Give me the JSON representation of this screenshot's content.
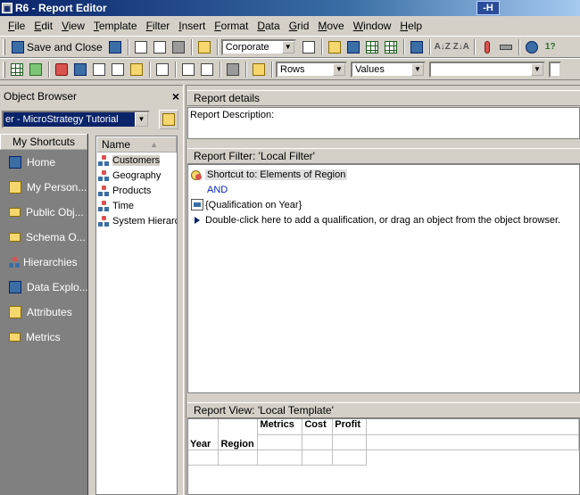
{
  "window": {
    "title": "R6 - Report Editor",
    "badge": "-H"
  },
  "menu": [
    "File",
    "Edit",
    "View",
    "Template",
    "Filter",
    "Insert",
    "Format",
    "Data",
    "Grid",
    "Move",
    "Window",
    "Help"
  ],
  "toolbar": {
    "save_close_label": "Save and Close",
    "style_combo": "Corporate",
    "rows_combo": "Rows",
    "values_combo": "Values",
    "extra_combo": "",
    "sort_asc": "A↓Z",
    "sort_desc": "Z↓A",
    "help_label": "1?"
  },
  "object_browser": {
    "title": "Object Browser",
    "close_glyph": "×",
    "project": "er - MicroStrategy Tutorial",
    "shortcuts_header": "My Shortcuts",
    "shortcuts": [
      {
        "label": "Home",
        "icon": "home-icon"
      },
      {
        "label": "My Person...",
        "icon": "my-personal-objects-icon"
      },
      {
        "label": "Public Obj...",
        "icon": "folder-icon"
      },
      {
        "label": "Schema O...",
        "icon": "folder-icon"
      },
      {
        "label": "Hierarchies",
        "icon": "hierarchy-icon"
      },
      {
        "label": "Data Explo...",
        "icon": "data-explorer-icon"
      },
      {
        "label": "Attributes",
        "icon": "attribute-icon"
      },
      {
        "label": "Metrics",
        "icon": "folder-icon"
      }
    ],
    "list_header": "Name",
    "list_sort_glyph": "▲",
    "items": [
      "Customers",
      "Geography",
      "Products",
      "Time",
      "System Hierarchy"
    ]
  },
  "report_details": {
    "title": "Report details",
    "description_label": "Report Description:"
  },
  "report_filter": {
    "title": "Report Filter: 'Local Filter'",
    "line1": "Shortcut to: Elements of Region",
    "operator": "AND",
    "line2": "{Qualification on Year}",
    "hint": "Double-click here to add a qualification, or drag an object from the object browser."
  },
  "report_view": {
    "title": "Report View: 'Local Template'",
    "metrics_label": "Metrics",
    "row_headers": [
      "Year",
      "Region"
    ],
    "metric_headers": [
      "Cost",
      "Profit"
    ]
  }
}
